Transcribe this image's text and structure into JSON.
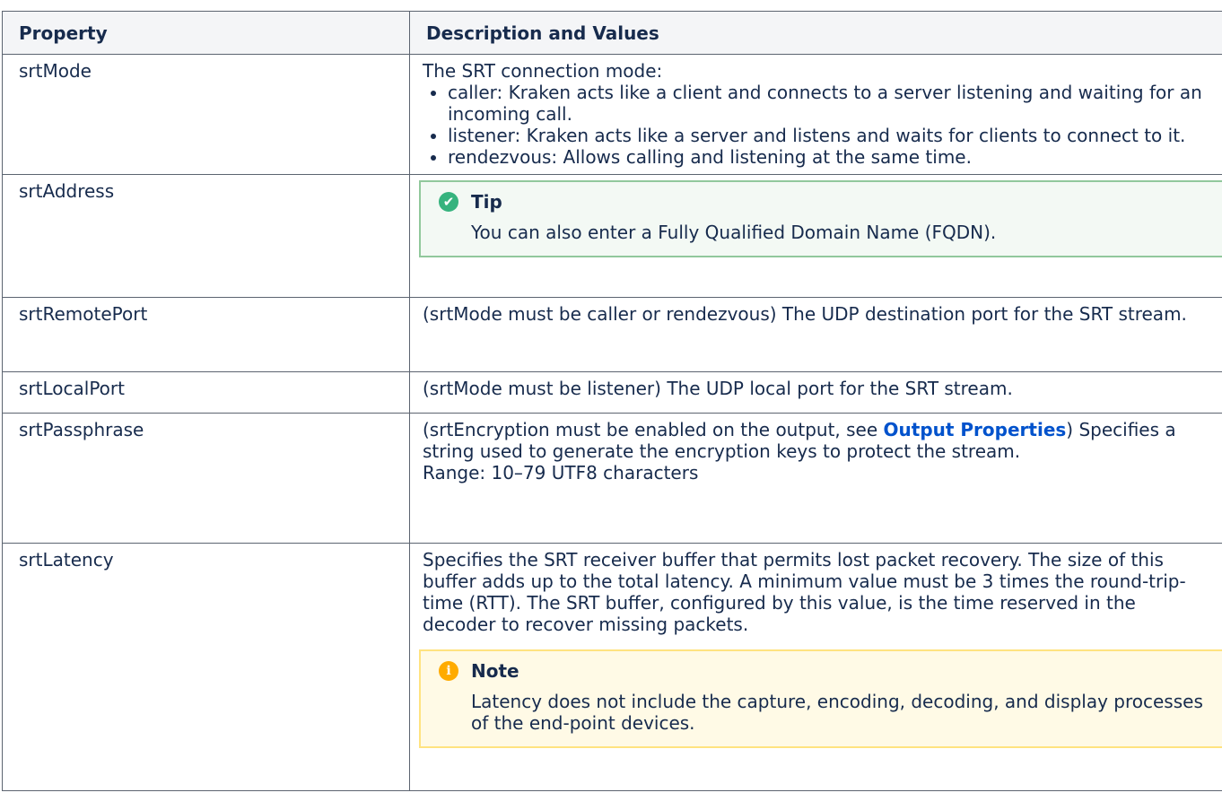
{
  "table": {
    "headers": [
      "Property",
      "Description and Values"
    ],
    "srtMode": {
      "name": "srtMode",
      "intro": "The SRT connection mode:",
      "items": [
        "caller: Kraken acts like a client and connects to a server listening and waiting for an incoming call.",
        "listener: Kraken acts like a server and listens and waits for clients to connect to it.",
        "rendezvous: Allows calling and listening at the same time."
      ]
    },
    "srtAddress": {
      "name": "srtAddress",
      "tip_title": "Tip",
      "tip_body": "You can also enter a Fully Qualified Domain Name (FQDN).",
      "tip_icon": "check-circle-icon"
    },
    "srtRemotePort": {
      "name": "srtRemotePort",
      "desc": "(srtMode must be caller or rendezvous) The UDP destination port for the SRT stream."
    },
    "srtLocalPort": {
      "name": "srtLocalPort",
      "desc": "(srtMode must be listener) The UDP local port for the SRT stream."
    },
    "srtPassphrase": {
      "name": "srtPassphrase",
      "desc_pre": "(srtEncryption must be enabled on the output, see ",
      "link": "Output Properties",
      "desc_post": ") Specifies a string used to generate the encryption keys to protect the stream.",
      "range": "Range: 10–79 UTF8 characters"
    },
    "srtLatency": {
      "name": "srtLatency",
      "desc": "Specifies the SRT receiver buffer that permits lost packet recovery. The size of this buffer adds up to the total latency. A minimum value must be 3 times the round-trip-time (RTT). The SRT buffer, configured by this value, is the time reserved in the decoder to recover missing packets.",
      "note_title": "Note",
      "note_body": "Latency does not include the capture, encoding, decoding, and display processes of the end-point devices.",
      "note_icon": "info-icon"
    }
  },
  "colors": {
    "tip_bg": "#f3f9f4",
    "tip_border": "#91c89c",
    "note_bg": "#fffae6",
    "note_border": "#ffe380",
    "link": "#0052cc",
    "header_bg": "#f4f5f7"
  }
}
